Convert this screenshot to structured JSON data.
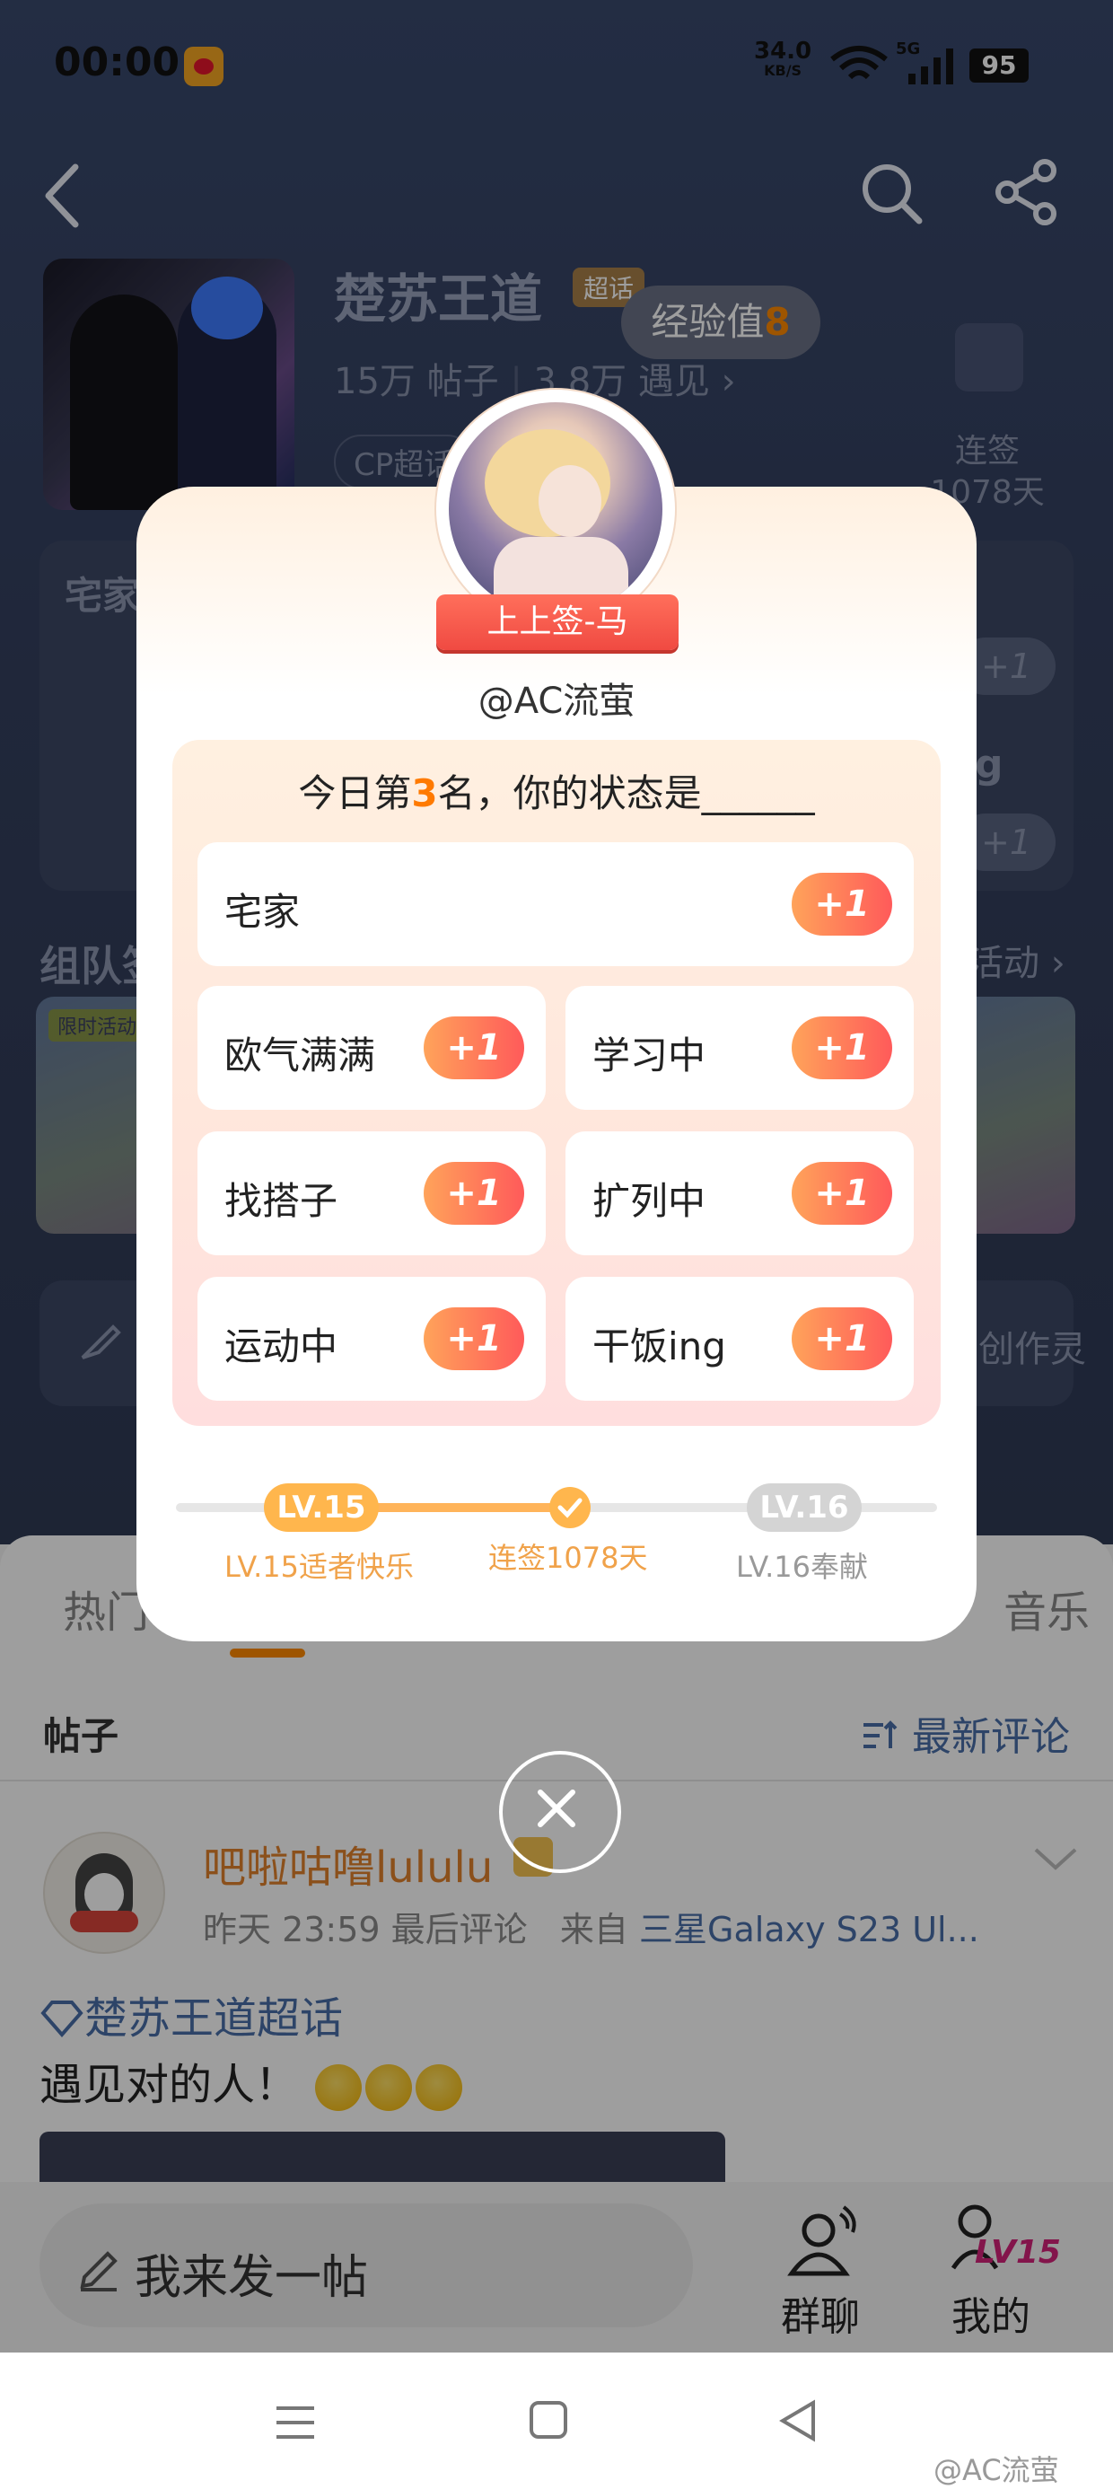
{
  "status_bar": {
    "time": "00:00",
    "net_speed": "34.0",
    "net_unit": "KB/S",
    "network": "5G",
    "battery": "95"
  },
  "header": {
    "back_icon": "back-arrow-icon",
    "search_icon": "search-icon",
    "share_icon": "share-icon"
  },
  "topic": {
    "name": "楚苏王道",
    "tag": "超话",
    "posts": "15万",
    "posts_label": "帖子",
    "meet": "3.8万",
    "meet_label": "遇见",
    "cp_tag": "CP超话"
  },
  "exp": {
    "label": "经验值",
    "value": "8"
  },
  "checkin": {
    "label": "连签",
    "days": "1078天"
  },
  "bg_sections": {
    "card_title": "宅家",
    "card_ing": "g",
    "plus": "+1",
    "group_title": "组队签",
    "activity_link": "活动",
    "banner_tag": "限时活动",
    "tools_text": "创作灵"
  },
  "tabs": {
    "left": "热门",
    "right": "音乐"
  },
  "posts_header": {
    "title": "帖子",
    "sort": "最新评论"
  },
  "post": {
    "author": "吧啦咕噜lululu",
    "time": "昨天 23:59 最后评论",
    "from": "来自",
    "device": "三星Galaxy S23 Ul...",
    "topic_link": "楚苏王道超话",
    "text": "遇见对的人！"
  },
  "bottom_bar": {
    "compose_placeholder": "我来发一帖",
    "group_chat": "群聊",
    "mine": "我的",
    "level_badge": "LV15"
  },
  "watermark": "@AC流萤",
  "modal": {
    "ribbon": "上上签-马",
    "handle": "@AC流萤",
    "question_prefix": "今日第",
    "rank": "3",
    "question_suffix": "名，你的状态是______",
    "options": [
      {
        "label": "宅家",
        "plus": "+1"
      },
      {
        "label": "欧气满满",
        "plus": "+1"
      },
      {
        "label": "学习中",
        "plus": "+1"
      },
      {
        "label": "找搭子",
        "plus": "+1"
      },
      {
        "label": "扩列中",
        "plus": "+1"
      },
      {
        "label": "运动中",
        "plus": "+1"
      },
      {
        "label": "干饭ing",
        "plus": "+1"
      }
    ],
    "progress": {
      "current_level": "LV.15",
      "current_caption": "LV.15适者快乐",
      "middle_caption": "连签1078天",
      "next_level": "LV.16",
      "next_caption": "LV.16奉献"
    },
    "close_icon": "close-icon"
  },
  "colors": {
    "accent": "#ff8a00",
    "plus_from": "#ffa35a",
    "plus_to": "#ff5a5a",
    "link": "#4a6fa8",
    "ribbon": "#f04a42"
  }
}
